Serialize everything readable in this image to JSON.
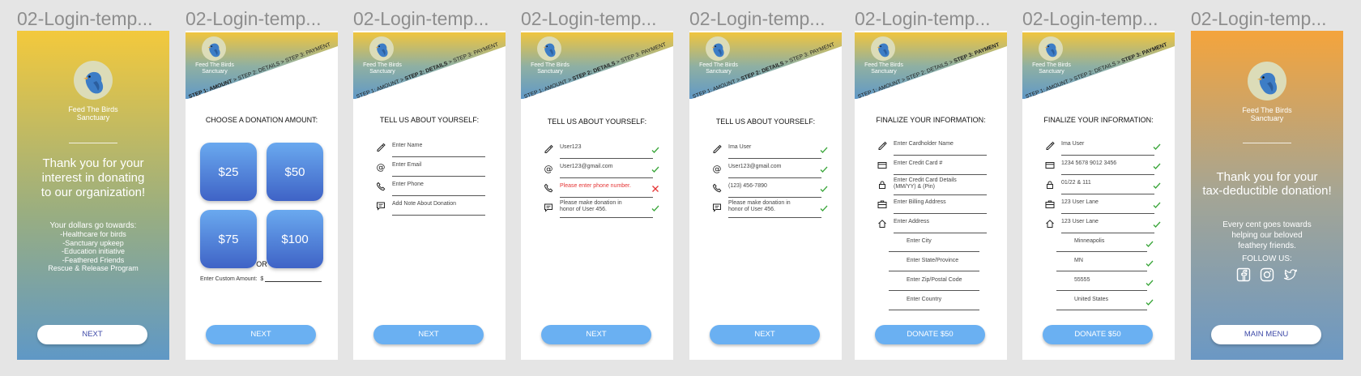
{
  "frame_titles": [
    "02-Login-temp...",
    "02-Login-temp...",
    "02-Login-temp...",
    "02-Login-temp...",
    "02-Login-temp...",
    "02-Login-temp...",
    "02-Login-temp...",
    "02-Login-temp..."
  ],
  "brand": {
    "line1": "Feed The Birds",
    "line2": "Sanctuary"
  },
  "steps": {
    "s1": "STEP 1: AMOUNT",
    "s2": "STEP 2: DETAILS",
    "s3": "STEP 3: PAYMENT",
    "sep": ">"
  },
  "welcome": {
    "message": [
      "Thank you for your",
      "interest in donating",
      "to our organization!"
    ],
    "dollars": [
      "Your dollars go towards:",
      "-Healthcare for birds",
      "-Sanctuary upkeep",
      "-Education initiative",
      "-Feathered Friends",
      "Rescue & Release Program"
    ],
    "button": "NEXT"
  },
  "amount": {
    "title": "CHOOSE A DONATION AMOUNT:",
    "options": [
      "$25",
      "$50",
      "$75",
      "$100"
    ],
    "or": "OR",
    "custom_label": "Enter Custom Amount:",
    "currency": "$",
    "button": "NEXT"
  },
  "about": {
    "title": "TELL US ABOUT YOURSELF:",
    "empty": [
      "Enter Name",
      "Enter Email",
      "Enter Phone",
      "Add Note About Donation"
    ],
    "error": [
      "User123",
      "User123@gmail.com",
      "Please enter phone number.",
      "Please make donation in",
      "honor of User 456."
    ],
    "filled": [
      "Ima User",
      "User123@gmail.com",
      "(123) 456-7890",
      "Please make donation in",
      "honor of User 456."
    ],
    "button": "NEXT"
  },
  "finalize": {
    "title": "FINALIZE YOUR INFORMATION:",
    "empty": [
      "Enter Cardholder Name",
      "Enter Credit Card #",
      "Enter Credit Card Details",
      "(MM/YY) & (Pin)",
      "Enter Billing Address",
      "Enter Address",
      "Enter City",
      "Enter State/Province",
      "Enter Zip/Postal Code",
      "Enter Country"
    ],
    "filled": [
      "Ima User",
      "1234 5678 9012 3456",
      "01/22 & 111",
      "123 User Lane",
      "123  User Lane",
      "Minneapolis",
      "MN",
      "55555",
      "United States"
    ],
    "button": "DONATE $50"
  },
  "thanks": {
    "message": [
      "Thank you for your",
      "tax-deductible donation!"
    ],
    "sub": [
      "Every cent goes towards",
      "helping our beloved",
      "feathery friends."
    ],
    "follow": "FOLLOW US:",
    "social_icons": [
      "facebook-icon",
      "instagram-icon",
      "twitter-icon"
    ],
    "button": "MAIN MENU"
  },
  "colors": {
    "accent": "#6ab0f2",
    "check": "#3aa63a",
    "error": "#e53535",
    "amount_top": "#6aa9ef",
    "amount_bottom": "#3f63c6"
  }
}
